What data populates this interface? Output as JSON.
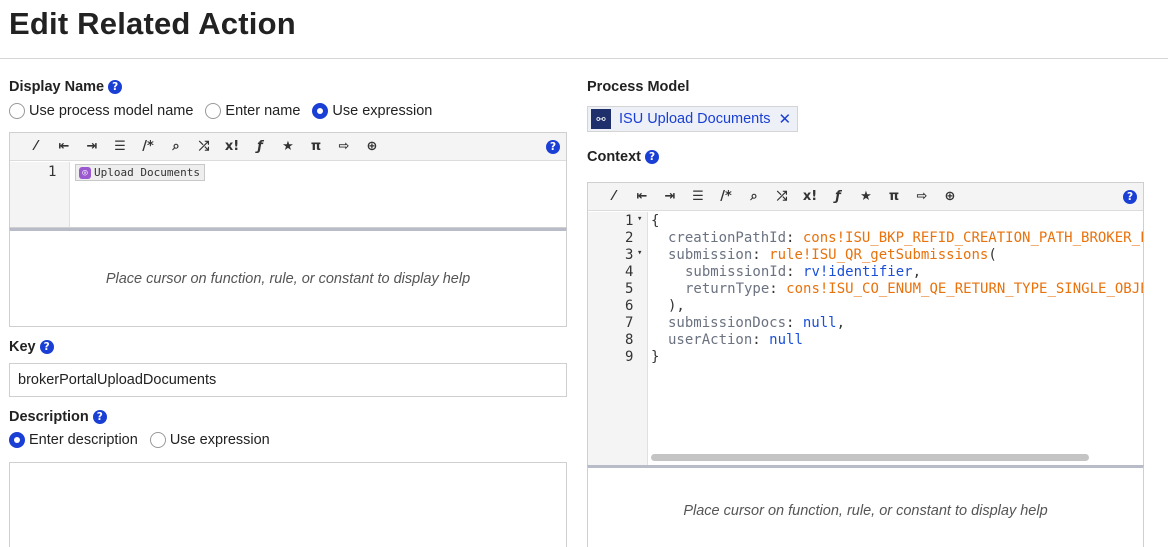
{
  "page": {
    "title": "Edit Related Action"
  },
  "display_name": {
    "label": "Display Name",
    "options": [
      "Use process model name",
      "Enter name",
      "Use expression"
    ],
    "selected": "Use expression",
    "editor": {
      "lines": [
        "1"
      ],
      "chip_icon": "rule-icon",
      "chip_text": "Upload Documents",
      "help_text": "Place cursor on function, rule, or constant to display help"
    }
  },
  "key": {
    "label": "Key",
    "value": "brokerPortalUploadDocuments"
  },
  "description": {
    "label": "Description",
    "options": [
      "Enter description",
      "Use expression"
    ],
    "selected": "Enter description",
    "value": ""
  },
  "process_model": {
    "label": "Process Model",
    "value": "ISU Upload Documents",
    "icon": "process-model-icon",
    "remove_icon": "close-icon"
  },
  "context": {
    "label": "Context",
    "help_text": "Place cursor on function, rule, or constant to display help",
    "line_numbers": [
      "1",
      "2",
      "3",
      "4",
      "5",
      "6",
      "7",
      "8",
      "9"
    ],
    "code": {
      "l1": "{",
      "l2_key": "creationPathId",
      "l2_val": "cons!ISU_BKP_REFID_CREATION_PATH_BROKER_F",
      "l3_key": "submission",
      "l3_val": "rule!ISU_QR_getSubmissions",
      "l4_key": "submissionId",
      "l4_val": "rv!identifier",
      "l5_key": "returnType",
      "l5_val": "cons!ISU_CO_ENUM_QE_RETURN_TYPE_SINGLE_OBJE",
      "l6": "),",
      "l7_key": "submissionDocs",
      "l7_val": "null",
      "l8_key": "userAction",
      "l8_val": "null",
      "l9": "}"
    }
  },
  "toolbar": {
    "icons": [
      "magic-wand-icon",
      "outdent-icon",
      "indent-icon",
      "format-icon",
      "comment-icon",
      "search-icon",
      "shuffle-icon",
      "clear-icon",
      "function-icon",
      "star-icon",
      "pi-icon",
      "export-icon",
      "globe-icon",
      "help-icon"
    ]
  },
  "colors": {
    "accent": "#1a3fd4",
    "constant": "#e8720c",
    "keyword": "#1a4fd8"
  }
}
